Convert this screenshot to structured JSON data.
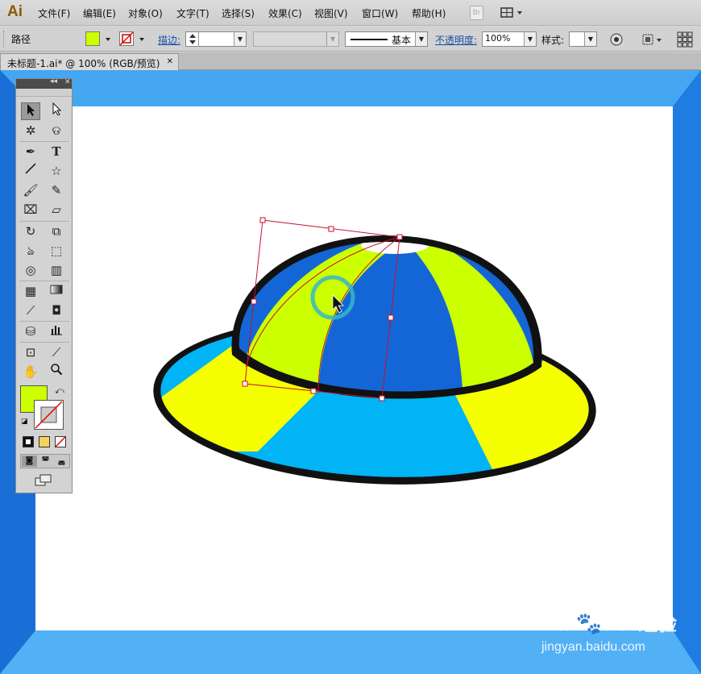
{
  "app": {
    "logo": "Ai"
  },
  "menu": [
    "文件(F)",
    "编辑(E)",
    "对象(O)",
    "文字(T)",
    "选择(S)",
    "效果(C)",
    "视图(V)",
    "窗口(W)",
    "帮助(H)"
  ],
  "menubar_extra": {
    "bridge_label": "Br"
  },
  "control": {
    "object_type": "路径",
    "stroke_label": "描边:",
    "stroke_style": "基本",
    "opacity_label": "不透明度:",
    "opacity_value": "100%",
    "style_label": "样式:"
  },
  "document": {
    "tab_title": "未标题-1.ai* @ 100% (RGB/预览)",
    "close_glyph": "✕"
  },
  "colors": {
    "fill": "#ccff00",
    "hat_blue": "#1466d6",
    "hat_lime": "#ccff00",
    "brim_cyan": "#00b4f5",
    "brim_yellow": "#f5ff00",
    "selection": "#c8102e",
    "pasteboard_blue": "#3da0f0"
  },
  "watermark": {
    "brand": "Bai",
    "brand2": "du",
    "cn": "经验",
    "url": "jingyan.baidu.com"
  },
  "icons": {
    "selection": "selection-tool-icon",
    "direct": "direct-selection-tool-icon",
    "magic": "magic-wand-icon",
    "lasso": "lasso-icon",
    "pen": "pen-icon",
    "type": "type-icon",
    "line": "line-icon",
    "star": "star-icon",
    "brush": "brush-icon",
    "pencil": "pencil-icon",
    "blob": "blob-brush-icon",
    "eraser": "eraser-icon",
    "rotate": "rotate-icon",
    "scale": "scale-icon",
    "warp": "warp-icon",
    "free": "free-transform-icon",
    "shape": "shape-builder-icon",
    "perspective": "perspective-grid-icon",
    "mesh": "mesh-icon",
    "gradient": "gradient-icon",
    "eyedropper": "eyedropper-icon",
    "blend": "blend-icon",
    "spray": "symbol-sprayer-icon",
    "graph": "column-graph-icon",
    "artboard": "artboard-icon",
    "slice": "slice-icon",
    "hand": "hand-icon",
    "zoom": "zoom-icon"
  }
}
